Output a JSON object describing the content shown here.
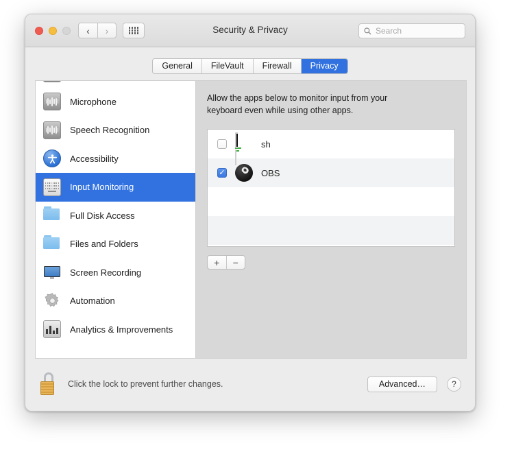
{
  "window": {
    "title": "Security & Privacy",
    "traffic_lights": [
      "close",
      "minimize",
      "zoom"
    ],
    "nav": {
      "back": "‹",
      "forward": "›"
    },
    "grid_button": "show-all-icon",
    "search": {
      "placeholder": "Search",
      "value": "",
      "icon": "search-icon"
    }
  },
  "tabs": [
    {
      "label": "General",
      "active": false
    },
    {
      "label": "FileVault",
      "active": false
    },
    {
      "label": "Firewall",
      "active": false
    },
    {
      "label": "Privacy",
      "active": true
    }
  ],
  "sidebar": {
    "items": [
      {
        "label": "",
        "icon": "camera-icon",
        "selected": false,
        "partial": true
      },
      {
        "label": "Microphone",
        "icon": "microphone-icon",
        "selected": false
      },
      {
        "label": "Speech Recognition",
        "icon": "speech-recognition-icon",
        "selected": false
      },
      {
        "label": "Accessibility",
        "icon": "accessibility-icon",
        "selected": false
      },
      {
        "label": "Input Monitoring",
        "icon": "keyboard-icon",
        "selected": true
      },
      {
        "label": "Full Disk Access",
        "icon": "folder-icon",
        "selected": false
      },
      {
        "label": "Files and Folders",
        "icon": "folder-icon",
        "selected": false
      },
      {
        "label": "Screen Recording",
        "icon": "display-icon",
        "selected": false
      },
      {
        "label": "Automation",
        "icon": "gear-icon",
        "selected": false
      },
      {
        "label": "Analytics & Improvements",
        "icon": "bar-chart-icon",
        "selected": false
      }
    ]
  },
  "pane": {
    "description": "Allow the apps below to monitor input from your keyboard even while using other apps.",
    "apps": [
      {
        "name": "sh",
        "checked": false,
        "icon": "terminal-icon"
      },
      {
        "name": "OBS",
        "checked": true,
        "icon": "obs-icon"
      }
    ],
    "add_label": "+",
    "remove_label": "−"
  },
  "footer": {
    "lock_icon": "unlocked-padlock-icon",
    "lock_text": "Click the lock to prevent further changes.",
    "advanced_label": "Advanced…",
    "help_label": "?"
  },
  "colors": {
    "accent": "#3272e0",
    "window_bg": "#ececec",
    "pane_bg": "#d8d8d8",
    "row_alt": "#f2f3f4"
  }
}
